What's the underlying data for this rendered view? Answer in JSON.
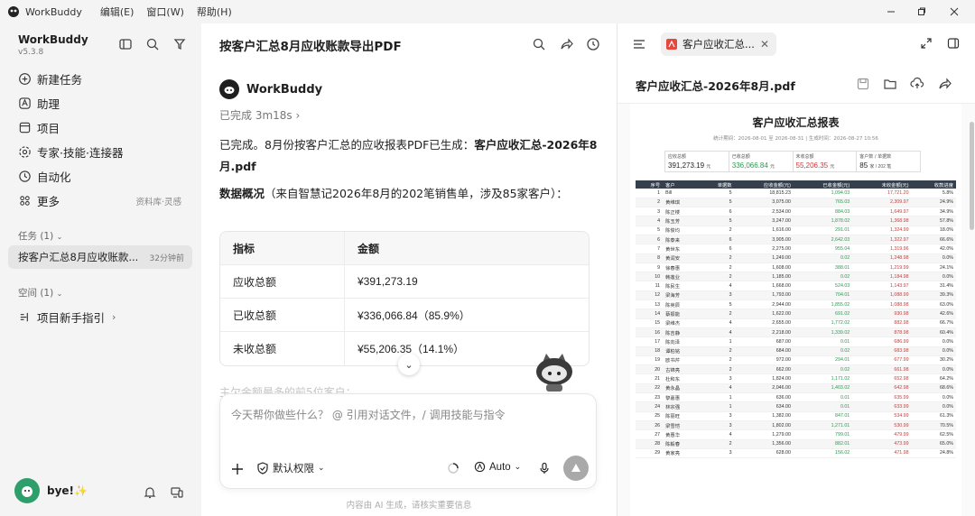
{
  "titlebar": {
    "app": "WorkBuddy",
    "menus": [
      "编辑(E)",
      "窗口(W)",
      "帮助(H)"
    ]
  },
  "sidebar": {
    "app_name": "WorkBuddy",
    "version": "v5.3.8",
    "nav": [
      {
        "label": "新建任务"
      },
      {
        "label": "助理"
      },
      {
        "label": "项目"
      },
      {
        "label": "专家·技能·连接器"
      },
      {
        "label": "自动化"
      },
      {
        "label": "更多",
        "extra": "资料库·灵感"
      }
    ],
    "tasks_header": "任务 (1)",
    "task": {
      "title": "按客户汇总8月应收账款...",
      "time": "32分钟前"
    },
    "space_header": "空间 (1)",
    "space_item": "项目新手指引",
    "user_name": "bye!✨"
  },
  "chat": {
    "title": "按客户汇总8月应收账款导出PDF",
    "bot_name": "WorkBuddy",
    "status": "已完成 3m18s",
    "p1a": "已完成。8月份按客户汇总的应收报表PDF已生成：",
    "p1b": "客户应收汇总-2026年8月.pdf",
    "p2a": "数据概况",
    "p2b": "（来自智慧记2026年8月的202笔销售单，涉及85家客户）：",
    "table": {
      "headers": [
        "指标",
        "金额"
      ],
      "rows": [
        [
          "应收总额",
          "¥391,273.19"
        ],
        [
          "已收总额",
          "¥336,066.84（85.9%）"
        ],
        [
          "未收总额",
          "¥55,206.35（14.1%）"
        ]
      ]
    },
    "faded": "主欠金额最多的前5位客户：",
    "input_placeholder": "今天帮你做些什么？ @ 引用对话文件，/ 调用技能与指令",
    "perm": "默认权限",
    "model": "Auto",
    "disclaimer": "内容由 AI 生成，请核实重要信息"
  },
  "preview": {
    "tab": "客户应收汇总...",
    "file": "客户应收汇总-2026年8月.pdf",
    "report": {
      "title": "客户应收汇总报表",
      "subtitle": "统计期间：2026-08-01 至 2026-08-31 | 生成时间：2026-08-27 10:56",
      "cards": [
        {
          "label": "应收总额",
          "value": "391,273.19",
          "unit": "元"
        },
        {
          "label": "已收总额",
          "value": "336,066.84",
          "unit": "元"
        },
        {
          "label": "未收总额",
          "value": "55,206.35",
          "unit": "元"
        },
        {
          "label": "客户数 / 单据数",
          "value": "85",
          "unit": "家 / 202 笔"
        }
      ],
      "headers": [
        "序号",
        "客户",
        "单据数",
        "应收金额(元)",
        "已收金额(元)",
        "未收金额(元)",
        "收款进度"
      ],
      "rows": [
        [
          "1",
          "Bill",
          "5",
          "18,815.23",
          "1,094.03",
          "17,721.20",
          "5.8%"
        ],
        [
          "2",
          "黄维琪",
          "5",
          "3,075.00",
          "765.03",
          "2,309.97",
          "24.9%"
        ],
        [
          "3",
          "陈正楼",
          "6",
          "2,534.00",
          "884.03",
          "1,649.97",
          "34.9%"
        ],
        [
          "4",
          "陈玉芳",
          "5",
          "3,247.00",
          "1,878.02",
          "1,368.98",
          "57.8%"
        ],
        [
          "5",
          "陈俊均",
          "2",
          "1,616.00",
          "291.01",
          "1,324.99",
          "18.0%"
        ],
        [
          "6",
          "陈泰来",
          "6",
          "3,905.00",
          "2,642.03",
          "1,322.97",
          "66.6%"
        ],
        [
          "7",
          "黄世东",
          "6",
          "2,275.00",
          "955.04",
          "1,319.96",
          "42.0%"
        ],
        [
          "8",
          "黄润安",
          "2",
          "1,249.00",
          "0.02",
          "1,248.98",
          "0.0%"
        ],
        [
          "9",
          "徐春惠",
          "2",
          "1,608.00",
          "388.01",
          "1,219.99",
          "24.1%"
        ],
        [
          "10",
          "韩莲业",
          "2",
          "1,185.00",
          "0.02",
          "1,184.98",
          "0.0%"
        ],
        [
          "11",
          "陈民生",
          "4",
          "1,668.00",
          "524.03",
          "1,143.97",
          "31.4%"
        ],
        [
          "12",
          "梁海芳",
          "3",
          "1,793.00",
          "704.01",
          "1,088.99",
          "39.3%"
        ],
        [
          "13",
          "陈英辰",
          "5",
          "2,944.00",
          "1,855.02",
          "1,088.98",
          "63.0%"
        ],
        [
          "14",
          "蔡振能",
          "2",
          "1,622.00",
          "691.02",
          "930.98",
          "42.6%"
        ],
        [
          "15",
          "梁维杰",
          "4",
          "2,655.00",
          "1,772.02",
          "882.98",
          "66.7%"
        ],
        [
          "16",
          "陈吉静",
          "4",
          "2,218.00",
          "1,339.02",
          "878.98",
          "60.4%"
        ],
        [
          "17",
          "陈向泽",
          "1",
          "687.00",
          "0.01",
          "686.99",
          "0.0%"
        ],
        [
          "18",
          "谭柏铭",
          "2",
          "684.00",
          "0.02",
          "683.98",
          "0.0%"
        ],
        [
          "19",
          "欧书芹",
          "2",
          "972.00",
          "294.01",
          "677.99",
          "30.2%"
        ],
        [
          "20",
          "古锦亮",
          "2",
          "662.00",
          "0.02",
          "661.98",
          "0.0%"
        ],
        [
          "21",
          "杜和东",
          "3",
          "1,824.00",
          "1,171.02",
          "652.98",
          "64.2%"
        ],
        [
          "22",
          "黄永晶",
          "4",
          "2,046.00",
          "1,403.02",
          "642.98",
          "68.6%"
        ],
        [
          "23",
          "黎嘉惠",
          "1",
          "636.00",
          "0.01",
          "635.99",
          "0.0%"
        ],
        [
          "24",
          "林宗强",
          "1",
          "634.00",
          "0.01",
          "633.99",
          "0.0%"
        ],
        [
          "25",
          "陈丽旺",
          "3",
          "1,382.00",
          "847.01",
          "534.99",
          "61.3%"
        ],
        [
          "26",
          "梁雪恺",
          "3",
          "1,802.00",
          "1,271.01",
          "530.99",
          "70.5%"
        ],
        [
          "27",
          "黄惠华",
          "4",
          "1,279.00",
          "799.01",
          "479.99",
          "62.5%"
        ],
        [
          "28",
          "陈毅春",
          "2",
          "1,356.00",
          "882.01",
          "473.99",
          "65.0%"
        ],
        [
          "29",
          "黄家亮",
          "3",
          "628.00",
          "156.02",
          "471.98",
          "24.8%"
        ]
      ]
    }
  }
}
